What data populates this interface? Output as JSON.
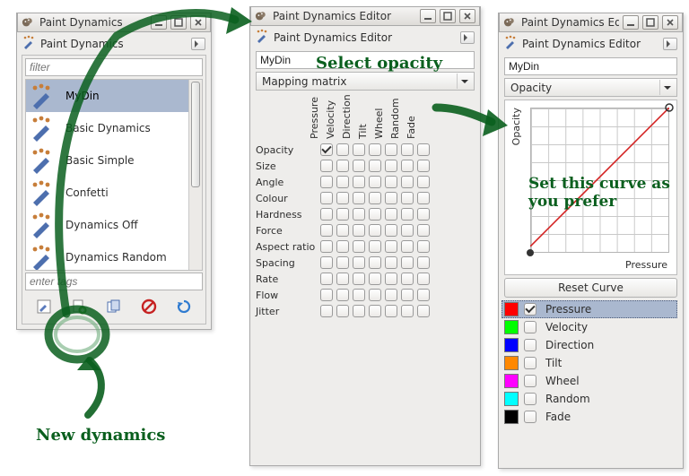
{
  "win_list": {
    "title": "Paint Dynamics",
    "dock_title": "Paint Dynamics",
    "filter_placeholder": "filter",
    "items": [
      {
        "label": "MyDin"
      },
      {
        "label": "Basic Dynamics"
      },
      {
        "label": "Basic Simple"
      },
      {
        "label": "Confetti"
      },
      {
        "label": "Dynamics Off"
      },
      {
        "label": "Dynamics Random"
      }
    ],
    "tags_placeholder": "enter tags"
  },
  "win_matrix": {
    "title": "Paint Dynamics Editor",
    "dock_title": "Paint Dynamics Editor",
    "name_value": "MyDin",
    "dropdown": "Mapping matrix",
    "columns": [
      "Pressure",
      "Velocity",
      "Direction",
      "Tilt",
      "Wheel",
      "Random",
      "Fade"
    ],
    "rows": [
      "Opacity",
      "Size",
      "Angle",
      "Colour",
      "Hardness",
      "Force",
      "Aspect ratio",
      "Spacing",
      "Rate",
      "Flow",
      "Jitter"
    ],
    "checked": {
      "row": 0,
      "col": 0
    }
  },
  "win_curve": {
    "title": "Paint Dynamics Editor",
    "dock_title": "Paint Dynamics Editor",
    "name_value": "MyDin",
    "dropdown": "Opacity",
    "y_axis": "Opacity",
    "x_axis": "Pressure",
    "reset": "Reset Curve",
    "legend": [
      {
        "label": "Pressure",
        "color": "#ff0000",
        "checked": true,
        "selected": true
      },
      {
        "label": "Velocity",
        "color": "#00ff00",
        "checked": false,
        "selected": false
      },
      {
        "label": "Direction",
        "color": "#0000ff",
        "checked": false,
        "selected": false
      },
      {
        "label": "Tilt",
        "color": "#ff8800",
        "checked": false,
        "selected": false
      },
      {
        "label": "Wheel",
        "color": "#ff00ff",
        "checked": false,
        "selected": false
      },
      {
        "label": "Random",
        "color": "#00ffff",
        "checked": false,
        "selected": false
      },
      {
        "label": "Fade",
        "color": "#000000",
        "checked": false,
        "selected": false
      }
    ]
  },
  "annotations": {
    "select_opacity": "Select opacity",
    "set_curve": "Set this curve as\nyou prefer",
    "new_dynamics": "New dynamics"
  }
}
